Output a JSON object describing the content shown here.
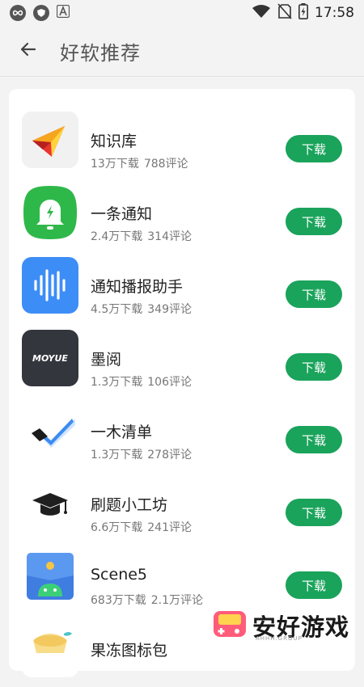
{
  "status_bar": {
    "time": "17:58",
    "left_icons": [
      "infinity-icon",
      "shield-icon",
      "letter-a-icon"
    ],
    "right_icons": [
      "wifi-icon",
      "no-sim-icon",
      "battery-charging-icon"
    ]
  },
  "header": {
    "back_icon": "back-arrow-icon",
    "title": "好软推荐"
  },
  "apps": [
    {
      "name": "知识库",
      "downloads": "13万下载",
      "reviews": "788评论",
      "button": "下载",
      "icon": "knowledge-base-icon"
    },
    {
      "name": "一条通知",
      "downloads": "2.4万下载",
      "reviews": "314评论",
      "button": "下载",
      "icon": "bell-notification-icon"
    },
    {
      "name": "通知播报助手",
      "downloads": "4.5万下载",
      "reviews": "349评论",
      "button": "下载",
      "icon": "sound-wave-icon"
    },
    {
      "name": "墨阅",
      "downloads": "1.3万下载",
      "reviews": "106评论",
      "button": "下载",
      "icon": "moyue-logo-icon"
    },
    {
      "name": "一木清单",
      "downloads": "1.3万下载",
      "reviews": "278评论",
      "button": "下载",
      "icon": "checkmark-pen-icon"
    },
    {
      "name": "刷题小工坊",
      "downloads": "6.6万下载",
      "reviews": "241评论",
      "button": "下载",
      "icon": "graduation-cap-icon"
    },
    {
      "name": "Scene5",
      "downloads": "683万下载",
      "reviews": "2.1万评论",
      "button": "下载",
      "icon": "android-folder-icon"
    },
    {
      "name": "果冻图标包",
      "downloads": "",
      "reviews": "",
      "button": "",
      "icon": "jelly-pudding-icon"
    }
  ],
  "watermark": {
    "text": "安好游戏",
    "sub": "AHHH.GROUP",
    "icon": "game-console-icon"
  },
  "colors": {
    "accent": "#1aa35b",
    "background": "#f3f3f3",
    "card": "#ffffff"
  }
}
